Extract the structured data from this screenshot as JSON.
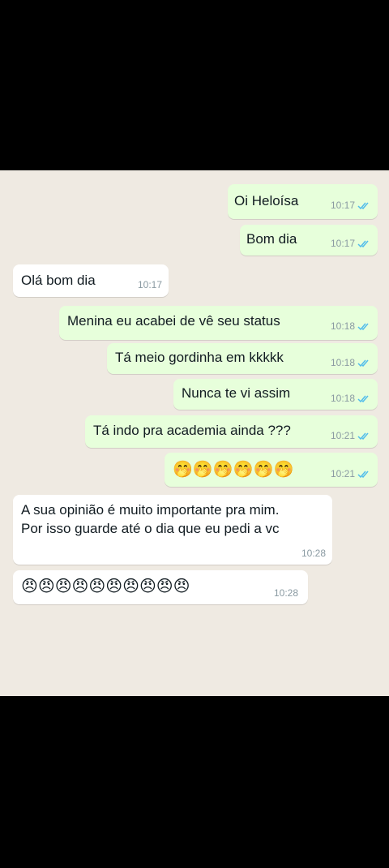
{
  "messages": [
    {
      "text": "Oi Heloísa",
      "time": "10:17"
    },
    {
      "text": "Bom dia",
      "time": "10:17"
    },
    {
      "text": "Olá bom dia",
      "time": "10:17"
    },
    {
      "text": "Menina eu acabei de vê seu status",
      "time": "10:18"
    },
    {
      "text": "Tá meio gordinha em kkkkk",
      "time": "10:18"
    },
    {
      "text": "Nunca te vi assim",
      "time": "10:18"
    },
    {
      "text": "Tá indo pra academia ainda ???",
      "time": "10:21"
    },
    {
      "text": "🤭🤭🤭🤭🤭🤭",
      "time": "10:21"
    },
    {
      "lines": [
        "A sua opinião é muito importante pra mim.",
        "Por isso guarde até o dia que eu pedi a vc"
      ],
      "time": "10:28"
    },
    {
      "text": "😠😠😠😠😠😠😠😠😠😠",
      "time": "10:28"
    }
  ],
  "colors": {
    "outgoing": "#e7ffdb",
    "incoming": "#ffffff",
    "background": "#efeae2",
    "read_ticks": "#53bdeb"
  },
  "icons": {
    "read_receipt": "double-check-icon"
  }
}
